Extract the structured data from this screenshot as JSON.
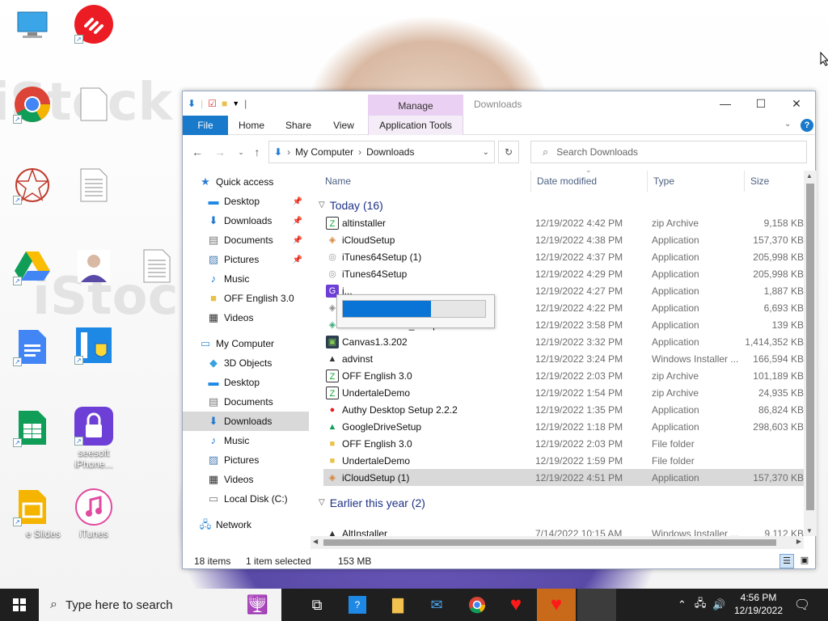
{
  "desktop": {
    "watermark": "iStock",
    "icons": [
      {
        "name": "computer",
        "label": ""
      },
      {
        "name": "authy",
        "label": ""
      },
      {
        "name": "chrome",
        "label": ""
      },
      {
        "name": "blank-file",
        "label": ""
      },
      {
        "name": "pattern-app",
        "label": ""
      },
      {
        "name": "text-file",
        "label": ""
      },
      {
        "name": "google-drive",
        "label": ""
      },
      {
        "name": "person-photo",
        "label": ""
      },
      {
        "name": "text-file-2",
        "label": ""
      },
      {
        "name": "google-docs",
        "label": ""
      },
      {
        "name": "installer-shield",
        "label": ""
      },
      {
        "name": "google-sheets",
        "label": ""
      },
      {
        "name": "aiseesoft",
        "label": "seesoft iPhone..."
      },
      {
        "name": "google-slides",
        "label": "e Slides"
      },
      {
        "name": "itunes",
        "label": "iTunes"
      }
    ]
  },
  "window": {
    "manage_tab": "Manage",
    "title": "Downloads",
    "ribbon": {
      "file": "File",
      "home": "Home",
      "share": "Share",
      "view": "View",
      "app_tools": "Application Tools"
    },
    "address": {
      "seg1": "My Computer",
      "seg2": "Downloads"
    },
    "search_placeholder": "Search Downloads",
    "sidebar": [
      {
        "label": "Quick access"
      },
      {
        "label": "Desktop"
      },
      {
        "label": "Downloads"
      },
      {
        "label": "Documents"
      },
      {
        "label": "Pictures"
      },
      {
        "label": "Music"
      },
      {
        "label": "OFF English 3.0"
      },
      {
        "label": "Videos"
      },
      {
        "label": "My Computer"
      },
      {
        "label": "3D Objects"
      },
      {
        "label": "Desktop"
      },
      {
        "label": "Documents"
      },
      {
        "label": "Downloads"
      },
      {
        "label": "Music"
      },
      {
        "label": "Pictures"
      },
      {
        "label": "Videos"
      },
      {
        "label": "Local Disk (C:)"
      },
      {
        "label": "Network"
      }
    ],
    "columns": {
      "name": "Name",
      "date": "Date modified",
      "type": "Type",
      "size": "Size"
    },
    "groups": {
      "today": "Today (16)",
      "earlier": "Earlier this year (2)"
    },
    "files": [
      {
        "name": "altinstaller",
        "date": "12/19/2022 4:42 PM",
        "type": "zip Archive",
        "size": "9,158 KB"
      },
      {
        "name": "iCloudSetup",
        "date": "12/19/2022 4:38 PM",
        "type": "Application",
        "size": "157,370 KB"
      },
      {
        "name": "iTunes64Setup (1)",
        "date": "12/19/2022 4:37 PM",
        "type": "Application",
        "size": "205,998 KB"
      },
      {
        "name": "iTunes64Setup",
        "date": "12/19/2022 4:29 PM",
        "type": "Application",
        "size": "205,998 KB"
      },
      {
        "name": "i...",
        "date": "12/19/2022 4:27 PM",
        "type": "Application",
        "size": "1,887 KB"
      },
      {
        "name": "",
        "date": "12/19/2022 4:22 PM",
        "type": "Application",
        "size": "6,693 KB"
      },
      {
        "name": "bluescreenview_setup",
        "date": "12/19/2022 3:58 PM",
        "type": "Application",
        "size": "139 KB"
      },
      {
        "name": "Canvas1.3.202",
        "date": "12/19/2022 3:32 PM",
        "type": "Application",
        "size": "1,414,352 KB"
      },
      {
        "name": "advinst",
        "date": "12/19/2022 3:24 PM",
        "type": "Windows Installer ...",
        "size": "166,594 KB"
      },
      {
        "name": "OFF English 3.0",
        "date": "12/19/2022 2:03 PM",
        "type": "zip Archive",
        "size": "101,189 KB"
      },
      {
        "name": "UndertaleDemo",
        "date": "12/19/2022 1:54 PM",
        "type": "zip Archive",
        "size": "24,935 KB"
      },
      {
        "name": "Authy Desktop Setup 2.2.2",
        "date": "12/19/2022 1:35 PM",
        "type": "Application",
        "size": "86,824 KB"
      },
      {
        "name": "GoogleDriveSetup",
        "date": "12/19/2022 1:18 PM",
        "type": "Application",
        "size": "298,603 KB"
      },
      {
        "name": "OFF English 3.0",
        "date": "12/19/2022 2:03 PM",
        "type": "File folder",
        "size": ""
      },
      {
        "name": "UndertaleDemo",
        "date": "12/19/2022 1:59 PM",
        "type": "File folder",
        "size": ""
      },
      {
        "name": "iCloudSetup (1)",
        "date": "12/19/2022 4:51 PM",
        "type": "Application",
        "size": "157,370 KB"
      }
    ],
    "earlier_files": [
      {
        "name": "AltInstaller",
        "date": "7/14/2022 10:15 AM",
        "type": "Windows Installer ...",
        "size": "9,112 KB"
      }
    ],
    "status": {
      "count": "18 items",
      "selected": "1 item selected",
      "size": "153 MB"
    },
    "progress_fraction": 0.62
  },
  "taskbar": {
    "search_placeholder": "Type here to search",
    "time": "4:56 PM",
    "date": "12/19/2022"
  }
}
